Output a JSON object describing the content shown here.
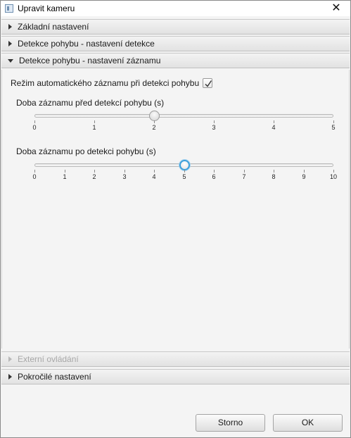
{
  "window": {
    "title": "Upravit kameru",
    "close_glyph": "✕",
    "icon": "camera-app-icon"
  },
  "sections": [
    {
      "label": "Základní nastavení",
      "state": "collapsed",
      "enabled": true
    },
    {
      "label": "Detekce pohybu - nastavení detekce",
      "state": "collapsed",
      "enabled": true
    },
    {
      "label": "Detekce pohybu - nastavení záznamu",
      "state": "expanded",
      "enabled": true
    },
    {
      "label": "Externí ovládání",
      "state": "collapsed",
      "enabled": false
    },
    {
      "label": "Pokročilé nastavení",
      "state": "collapsed",
      "enabled": true
    }
  ],
  "recording": {
    "auto_record_label": "Režim automatického záznamu při detekci pohybu",
    "auto_record_checked": true,
    "pre_record": {
      "label": "Doba záznamu před detekcí pohybu (s)",
      "min": 0,
      "max": 5,
      "value": 2,
      "ticks": [
        "0",
        "1",
        "2",
        "3",
        "4",
        "5"
      ]
    },
    "post_record": {
      "label": "Doba záznamu po detekci pohybu (s)",
      "min": 0,
      "max": 10,
      "value": 5,
      "ticks": [
        "0",
        "1",
        "2",
        "3",
        "4",
        "5",
        "6",
        "7",
        "8",
        "9",
        "10"
      ]
    }
  },
  "buttons": {
    "cancel": "Storno",
    "ok": "OK"
  },
  "colors": {
    "focus_accent": "#3b9fdb",
    "disabled_text": "#a8a8a8"
  }
}
